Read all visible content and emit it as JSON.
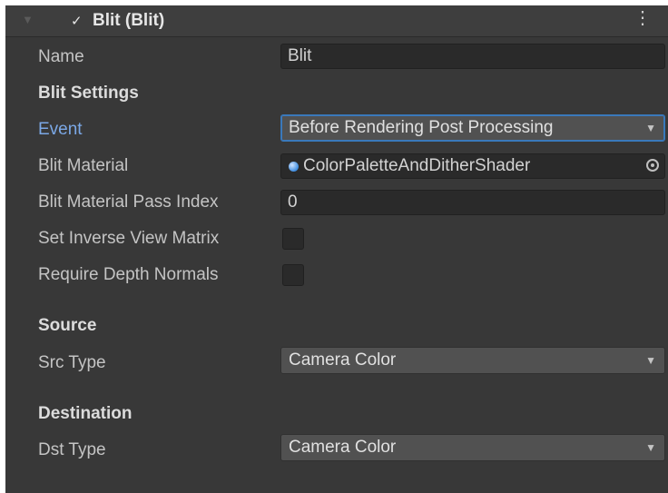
{
  "header": {
    "foldout_icon": "triangle-down",
    "enabled": true,
    "title": "Blit (Blit)",
    "menu_icon": "vertical-ellipsis"
  },
  "fields": {
    "name_label": "Name",
    "name_value": "Blit",
    "blit_settings_heading": "Blit Settings",
    "event_label": "Event",
    "event_value": "Before Rendering Post Processing",
    "material_label": "Blit Material",
    "material_value": "ColorPaletteAndDitherShader",
    "pass_index_label": "Blit Material Pass Index",
    "pass_index_value": "0",
    "inverse_view_label": "Set Inverse View Matrix",
    "inverse_view_checked": false,
    "depth_normals_label": "Require Depth Normals",
    "depth_normals_checked": false
  },
  "source": {
    "heading": "Source",
    "src_type_label": "Src Type",
    "src_type_value": "Camera Color"
  },
  "destination": {
    "heading": "Destination",
    "dst_type_label": "Dst Type",
    "dst_type_value": "Camera Color"
  },
  "colors": {
    "panel_bg": "#383838",
    "label_active": "#7ba8e6",
    "focus_border": "#3a79bb"
  }
}
